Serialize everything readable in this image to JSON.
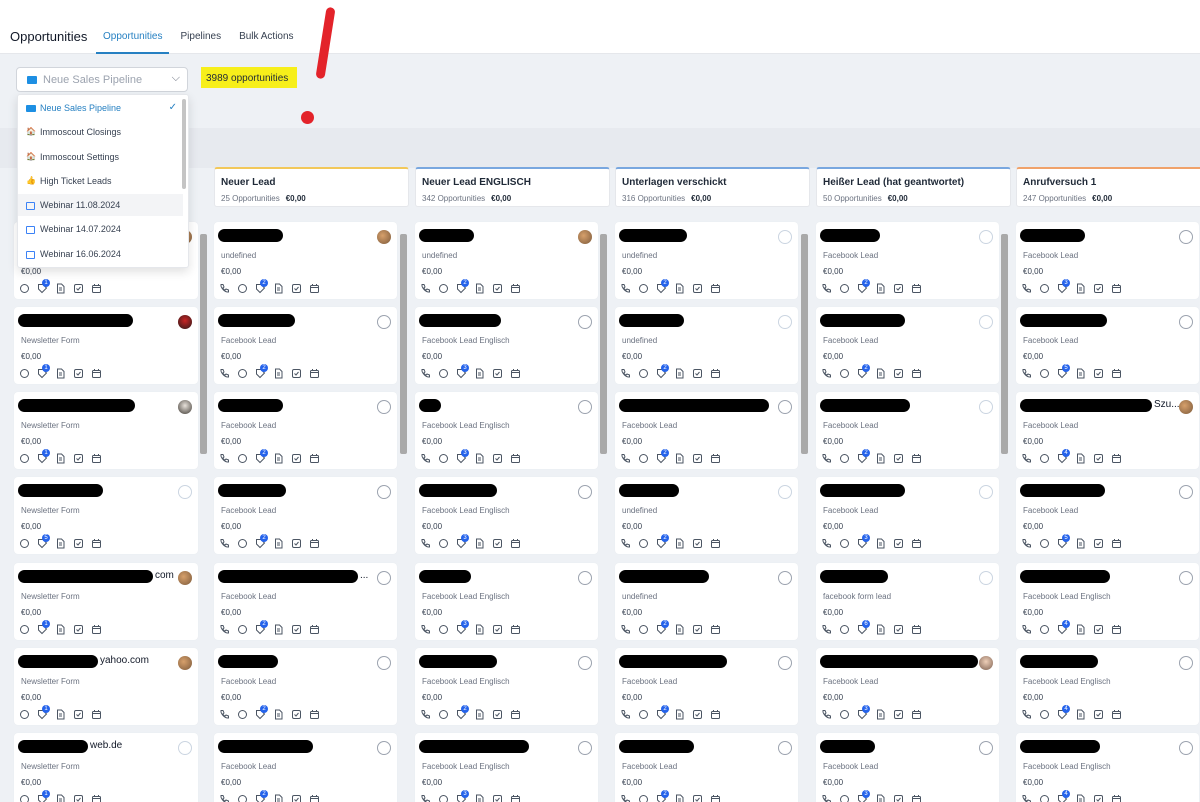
{
  "header": {
    "title": "Opportunities",
    "tabs": [
      {
        "label": "Opportunities"
      },
      {
        "label": "Pipelines"
      },
      {
        "label": "Bulk Actions"
      }
    ]
  },
  "toolbar": {
    "pipeline_value": "Neue Sales Pipeline",
    "opportunity_count": "3989 opportunities"
  },
  "dropdown": {
    "options": [
      {
        "label": "Neue Sales Pipeline",
        "icon": "logo-icon"
      },
      {
        "label": "Immoscout Closings",
        "icon": "house-icon"
      },
      {
        "label": "Immoscout Settings",
        "icon": "house-icon"
      },
      {
        "label": "High Ticket Leads",
        "icon": "thumbs-up-icon"
      },
      {
        "label": "Webinar 11.08.2024",
        "icon": "calendar-icon"
      },
      {
        "label": "Webinar 14.07.2024",
        "icon": "calendar-icon"
      },
      {
        "label": "Webinar 16.06.2024",
        "icon": "calendar-icon"
      }
    ]
  },
  "stages": [
    {
      "name": "Neuer Lead",
      "count": "25 Opportunities",
      "amount": "€0,00"
    },
    {
      "name": "Neuer Lead ENGLISCH",
      "count": "342 Opportunities",
      "amount": "€0,00"
    },
    {
      "name": "Unterlagen verschickt",
      "count": "316 Opportunities",
      "amount": "€0,00"
    },
    {
      "name": "Heißer Lead (hat geantwortet)",
      "count": "50 Opportunities",
      "amount": "€0,00"
    },
    {
      "name": "Anrufversuch 1",
      "count": "247 Opportunities",
      "amount": "€0,00"
    }
  ],
  "columns": [
    {
      "cards": [
        {
          "suffix": "",
          "source": "",
          "amount": "€0,00",
          "badge": "1"
        },
        {
          "suffix": "",
          "source": "Newsletter Form",
          "amount": "€0,00",
          "badge": "1"
        },
        {
          "suffix": "",
          "source": "Newsletter Form",
          "amount": "€0,00",
          "badge": "1"
        },
        {
          "suffix": "",
          "source": "Newsletter Form",
          "amount": "€0,00",
          "badge": "5"
        },
        {
          "suffix": "com",
          "source": "Newsletter Form",
          "amount": "€0,00",
          "badge": "1"
        },
        {
          "suffix": "yahoo.com",
          "source": "Newsletter Form",
          "amount": "€0,00",
          "badge": "1"
        },
        {
          "suffix": "web.de",
          "source": "Newsletter Form",
          "amount": "€0,00",
          "badge": "1"
        }
      ]
    },
    {
      "cards": [
        {
          "suffix": "",
          "source": "undefined",
          "amount": "€0,00",
          "badge": "2"
        },
        {
          "suffix": "",
          "source": "Facebook Lead",
          "amount": "€0,00",
          "badge": "2"
        },
        {
          "suffix": "",
          "source": "Facebook Lead",
          "amount": "€0,00",
          "badge": "2"
        },
        {
          "suffix": "",
          "source": "Facebook Lead",
          "amount": "€0,00",
          "badge": "2"
        },
        {
          "suffix": "...",
          "source": "Facebook Lead",
          "amount": "€0,00",
          "badge": "2"
        },
        {
          "suffix": "",
          "source": "Facebook Lead",
          "amount": "€0,00",
          "badge": "2"
        },
        {
          "suffix": "",
          "source": "Facebook Lead",
          "amount": "€0,00",
          "badge": "2"
        }
      ]
    },
    {
      "cards": [
        {
          "suffix": "",
          "source": "undefined",
          "amount": "€0,00",
          "badge": "2"
        },
        {
          "suffix": "",
          "source": "Facebook Lead Englisch",
          "amount": "€0,00",
          "badge": "3"
        },
        {
          "suffix": "",
          "source": "Facebook Lead Englisch",
          "amount": "€0,00",
          "badge": "3"
        },
        {
          "suffix": "",
          "source": "Facebook Lead Englisch",
          "amount": "€0,00",
          "badge": "3"
        },
        {
          "suffix": "",
          "source": "Facebook Lead Englisch",
          "amount": "€0,00",
          "badge": "3"
        },
        {
          "suffix": "",
          "source": "Facebook Lead Englisch",
          "amount": "€0,00",
          "badge": "2"
        },
        {
          "suffix": "",
          "source": "Facebook Lead Englisch",
          "amount": "€0,00",
          "badge": "3"
        }
      ]
    },
    {
      "cards": [
        {
          "suffix": "",
          "source": "undefined",
          "amount": "€0,00",
          "badge": "2"
        },
        {
          "suffix": "",
          "source": "undefined",
          "amount": "€0,00",
          "badge": "2"
        },
        {
          "suffix": "",
          "source": "Facebook Lead",
          "amount": "€0,00",
          "badge": "2"
        },
        {
          "suffix": "",
          "source": "undefined",
          "amount": "€0,00",
          "badge": "2"
        },
        {
          "suffix": "",
          "source": "undefined",
          "amount": "€0,00",
          "badge": "2"
        },
        {
          "suffix": "",
          "source": "Facebook Lead",
          "amount": "€0,00",
          "badge": "2"
        },
        {
          "suffix": "",
          "source": "Facebook Lead",
          "amount": "€0,00",
          "badge": "2"
        }
      ]
    },
    {
      "cards": [
        {
          "suffix": "",
          "source": "Facebook Lead",
          "amount": "€0,00",
          "badge": "2"
        },
        {
          "suffix": "",
          "source": "Facebook Lead",
          "amount": "€0,00",
          "badge": "2"
        },
        {
          "suffix": "",
          "source": "Facebook Lead",
          "amount": "€0,00",
          "badge": "2"
        },
        {
          "suffix": "",
          "source": "Facebook Lead",
          "amount": "€0,00",
          "badge": "3"
        },
        {
          "suffix": "",
          "source": "facebook form lead",
          "amount": "€0,00",
          "badge": "6"
        },
        {
          "suffix": "",
          "source": "Facebook Lead",
          "amount": "€0,00",
          "badge": "3"
        },
        {
          "suffix": "",
          "source": "Facebook Lead",
          "amount": "€0,00",
          "badge": "3"
        }
      ]
    },
    {
      "cards": [
        {
          "suffix": "",
          "source": "Facebook Lead",
          "amount": "€0,00",
          "badge": "3"
        },
        {
          "suffix": "",
          "source": "Facebook Lead",
          "amount": "€0,00",
          "badge": "5"
        },
        {
          "suffix": "Szu...",
          "source": "Facebook Lead",
          "amount": "€0,00",
          "badge": "4"
        },
        {
          "suffix": "",
          "source": "Facebook Lead",
          "amount": "€0,00",
          "badge": "5"
        },
        {
          "suffix": "",
          "source": "Facebook Lead Englisch",
          "amount": "€0,00",
          "badge": "4"
        },
        {
          "suffix": "",
          "source": "Facebook Lead Englisch",
          "amount": "€0,00",
          "badge": "4"
        },
        {
          "suffix": "",
          "source": "Facebook Lead Englisch",
          "amount": "€0,00",
          "badge": "4"
        }
      ]
    }
  ],
  "colors": {
    "accent": "#2680c2",
    "highlight": "#f7ef1a",
    "annotation_red": "#e3232a",
    "badge_blue": "#2563eb"
  }
}
